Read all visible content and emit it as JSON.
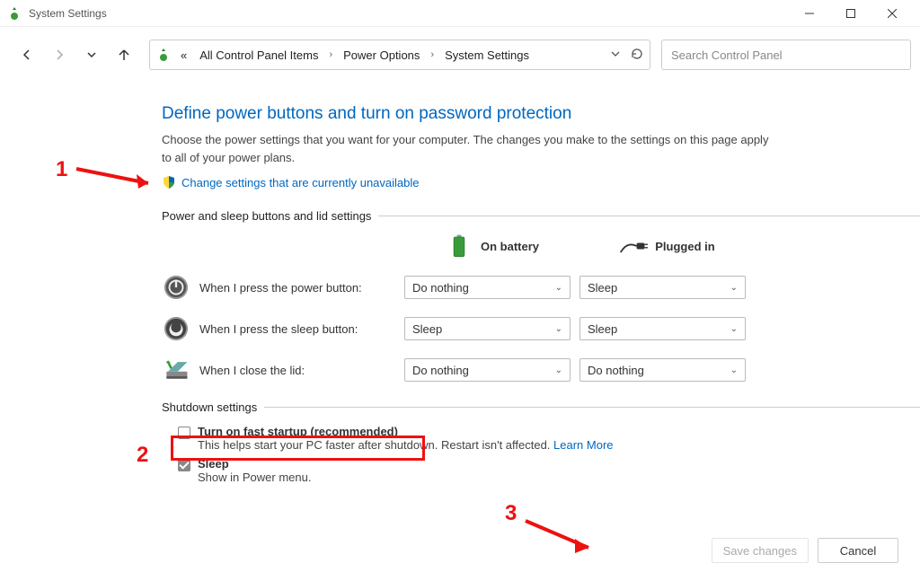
{
  "window": {
    "title": "System Settings"
  },
  "breadcrumb": {
    "prefix": "«",
    "items": [
      "All Control Panel Items",
      "Power Options",
      "System Settings"
    ]
  },
  "search": {
    "placeholder": "Search Control Panel"
  },
  "page": {
    "heading": "Define power buttons and turn on password protection",
    "description": "Choose the power settings that you want for your computer. The changes you make to the settings on this page apply to all of your power plans.",
    "change_link": "Change settings that are currently unavailable",
    "section1": "Power and sleep buttons and lid settings",
    "col_battery": "On battery",
    "col_plugged": "Plugged in",
    "rows": [
      {
        "label": "When I press the power button:",
        "battery": "Do nothing",
        "plugged": "Sleep"
      },
      {
        "label": "When I press the sleep button:",
        "battery": "Sleep",
        "plugged": "Sleep"
      },
      {
        "label": "When I close the lid:",
        "battery": "Do nothing",
        "plugged": "Do nothing"
      }
    ],
    "section2": "Shutdown settings",
    "fast_startup_label": "Turn on fast startup (recommended)",
    "fast_startup_sub_a": "This helps start your PC faster after shutdown. Restart isn't affected. ",
    "learn_more": "Learn More",
    "sleep_label": "Sleep",
    "sleep_sub": "Show in Power menu."
  },
  "buttons": {
    "save": "Save changes",
    "cancel": "Cancel"
  },
  "annotations": {
    "n1": "1",
    "n2": "2",
    "n3": "3"
  }
}
